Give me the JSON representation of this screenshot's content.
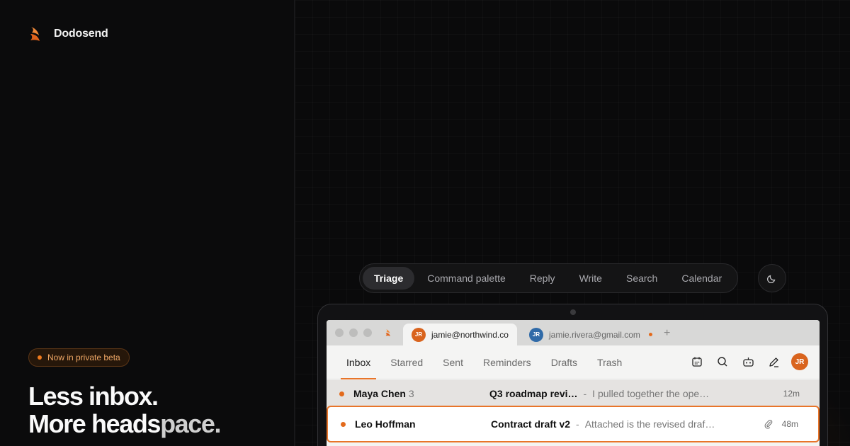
{
  "brand": {
    "name": "Dodosend",
    "accent": "#e8752a"
  },
  "hero": {
    "badge": "Now in private beta",
    "headline_line1": "Less inbox.",
    "headline_line2_a": "More heads",
    "headline_line2_b": "pace."
  },
  "feature_tabs": [
    {
      "label": "Triage",
      "active": true
    },
    {
      "label": "Command palette",
      "active": false
    },
    {
      "label": "Reply",
      "active": false
    },
    {
      "label": "Write",
      "active": false
    },
    {
      "label": "Search",
      "active": false
    },
    {
      "label": "Calendar",
      "active": false
    }
  ],
  "theme_toggle_icon": "moon-icon",
  "app": {
    "accounts": [
      {
        "initials": "JR",
        "email": "jamie@northwind.co",
        "active": true
      },
      {
        "initials": "JR",
        "email": "jamie.rivera@gmail.com",
        "active": false,
        "unread": true
      }
    ],
    "add_tab_label": "+",
    "nav": [
      {
        "label": "Inbox",
        "active": true
      },
      {
        "label": "Starred"
      },
      {
        "label": "Sent"
      },
      {
        "label": "Reminders"
      },
      {
        "label": "Drafts"
      },
      {
        "label": "Trash"
      }
    ],
    "tool_icons": [
      "calendar-icon",
      "search-icon",
      "bot-icon",
      "compose-icon"
    ],
    "user_initials": "JR",
    "emails": [
      {
        "sender": "Maya Chen",
        "count": "3",
        "subject": "Q3 roadmap revi…",
        "separator": "-",
        "preview": "I pulled together the ope…",
        "time": "12m",
        "attachment": false
      },
      {
        "sender": "Leo Hoffman",
        "count": "",
        "subject": "Contract draft v2",
        "separator": "-",
        "preview": "Attached is the revised draf…",
        "time": "48m",
        "attachment": true
      }
    ]
  }
}
